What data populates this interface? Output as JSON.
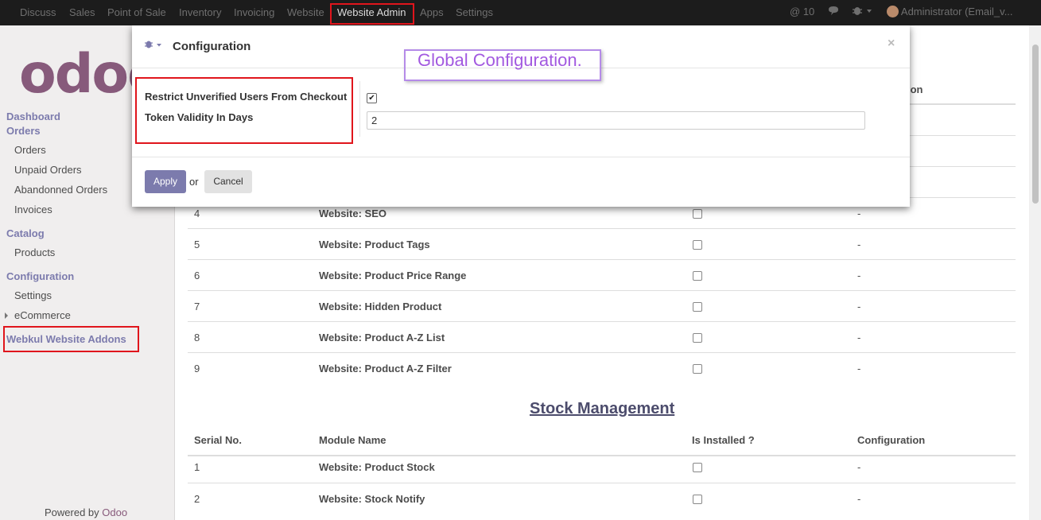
{
  "topnav": {
    "items": [
      "Discuss",
      "Sales",
      "Point of Sale",
      "Inventory",
      "Invoicing",
      "Website",
      "Website Admin",
      "Apps",
      "Settings"
    ],
    "mentions_count": "10",
    "user": "Administrator (Email_v..."
  },
  "sidebar": {
    "logo": "odoo",
    "sections": [
      {
        "heading": "Dashboard"
      },
      {
        "heading": "Orders",
        "items": [
          "Orders",
          "Unpaid Orders",
          "Abandonned Orders",
          "Invoices"
        ]
      },
      {
        "heading": "Catalog",
        "items": [
          "Products"
        ]
      },
      {
        "heading": "Configuration",
        "items": [
          "Settings",
          "eCommerce"
        ]
      },
      {
        "heading": "Webkul Website Addons"
      }
    ],
    "powered_by": "Powered by",
    "powered_brand": "Odoo"
  },
  "main": {
    "partial_header": "ion",
    "rows_top": [
      {
        "serial": "4",
        "module": "Website: SEO",
        "installed": false,
        "config": "-"
      },
      {
        "serial": "5",
        "module": "Website: Product Tags",
        "installed": false,
        "config": "-"
      },
      {
        "serial": "6",
        "module": "Website: Product Price Range",
        "installed": false,
        "config": "-"
      },
      {
        "serial": "7",
        "module": "Website: Hidden Product",
        "installed": false,
        "config": "-"
      },
      {
        "serial": "8",
        "module": "Website: Product A-Z List",
        "installed": false,
        "config": "-"
      },
      {
        "serial": "9",
        "module": "Website: Product A-Z Filter",
        "installed": false,
        "config": "-"
      }
    ],
    "stock_section": {
      "title": "Stock Management",
      "columns": [
        "Serial No.",
        "Module Name",
        "Is Installed ?",
        "Configuration"
      ],
      "rows": [
        {
          "serial": "1",
          "module": "Website: Product Stock",
          "installed": false,
          "config": "-"
        },
        {
          "serial": "2",
          "module": "Website: Stock Notify",
          "installed": false,
          "config": "-"
        }
      ]
    }
  },
  "modal": {
    "title": "Configuration",
    "annotation": "Global Configuration.",
    "fields": [
      {
        "label": "Restrict Unverified Users From Checkout",
        "type": "checkbox",
        "checked": true
      },
      {
        "label": "Token Validity In Days",
        "type": "number",
        "value": "2"
      }
    ],
    "apply_label": "Apply",
    "or_label": "or",
    "cancel_label": "Cancel",
    "close_glyph": "×"
  },
  "colors": {
    "brand": "#875a7b",
    "accent": "#7c7bad",
    "highlight_red": "#e0151c",
    "annotation_purple": "#a259e0"
  }
}
